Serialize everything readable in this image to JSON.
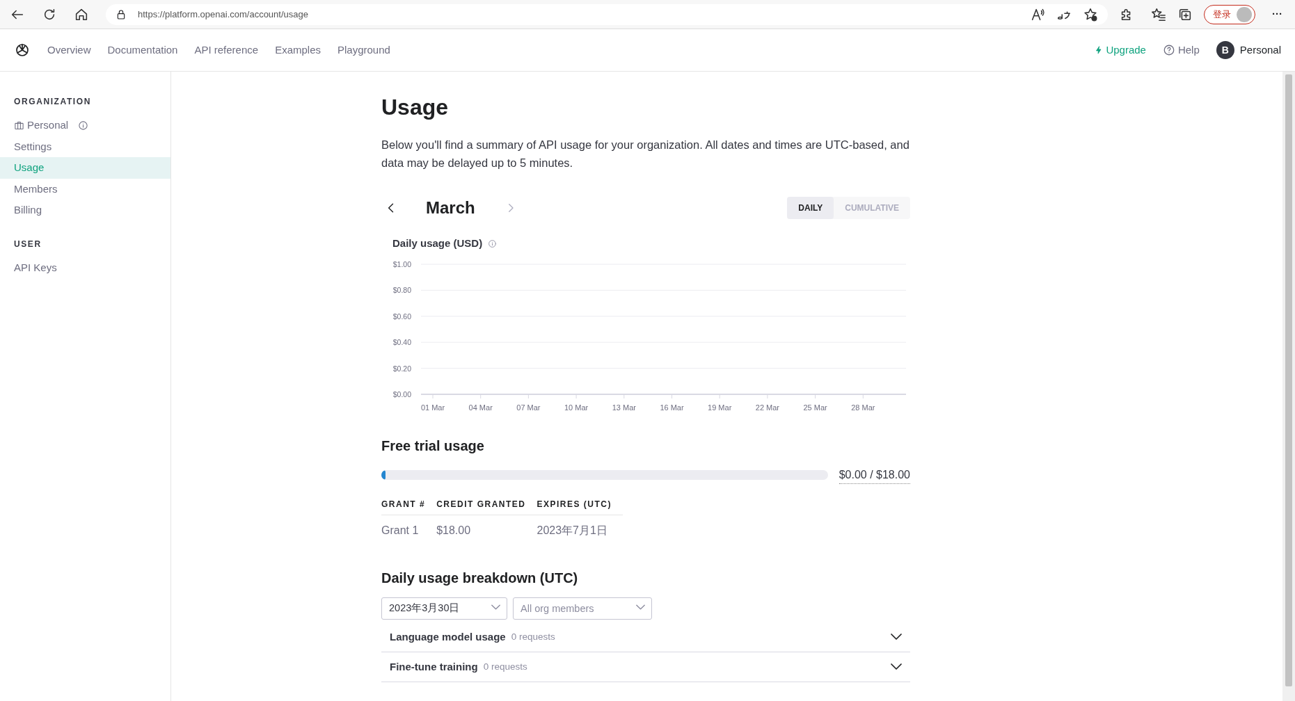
{
  "browser": {
    "url": "https://platform.openai.com/account/usage",
    "login_button": "登录",
    "more": "···"
  },
  "nav": {
    "items": [
      {
        "label": "Overview"
      },
      {
        "label": "Documentation"
      },
      {
        "label": "API reference"
      },
      {
        "label": "Examples"
      },
      {
        "label": "Playground"
      }
    ],
    "upgrade": "Upgrade",
    "help": "Help",
    "avatar_letter": "B",
    "account": "Personal"
  },
  "sidebar": {
    "sections": [
      {
        "heading": "ORGANIZATION",
        "items": [
          {
            "label": "Personal",
            "kind": "org",
            "selected": false
          },
          {
            "label": "Settings",
            "kind": "link",
            "selected": false
          },
          {
            "label": "Usage",
            "kind": "link",
            "selected": true
          },
          {
            "label": "Members",
            "kind": "link",
            "selected": false
          },
          {
            "label": "Billing",
            "kind": "link",
            "selected": false
          }
        ]
      },
      {
        "heading": "USER",
        "items": [
          {
            "label": "API Keys",
            "kind": "link",
            "selected": false
          }
        ]
      }
    ]
  },
  "page": {
    "title": "Usage",
    "description": "Below you'll find a summary of API usage for your organization. All dates and times are UTC-based, and data may be delayed up to 5 minutes.",
    "month": "March",
    "view_toggle": [
      {
        "label": "DAILY",
        "selected": true
      },
      {
        "label": "CUMULATIVE",
        "selected": false
      }
    ],
    "chart_data": {
      "type": "bar",
      "title": "Daily usage (USD)",
      "categories": [
        "01 Mar",
        "04 Mar",
        "07 Mar",
        "10 Mar",
        "13 Mar",
        "16 Mar",
        "19 Mar",
        "22 Mar",
        "25 Mar",
        "28 Mar"
      ],
      "values": [
        0,
        0,
        0,
        0,
        0,
        0,
        0,
        0,
        0,
        0
      ],
      "ylim": [
        0,
        1
      ],
      "grid": true,
      "yticks": [
        {
          "value": 0,
          "label": "$0.00"
        },
        {
          "value": 0.2,
          "label": "$0.20"
        },
        {
          "value": 0.4,
          "label": "$0.40"
        },
        {
          "value": 0.6,
          "label": "$0.60"
        },
        {
          "value": 0.8,
          "label": "$0.80"
        },
        {
          "value": 1,
          "label": "$1.00"
        }
      ]
    }
  },
  "free_trial": {
    "title": "Free trial usage",
    "level": 0.01,
    "reading": "$0.00 / $18.00",
    "columns": [
      "GRANT #",
      "CREDIT GRANTED",
      "EXPIRES (UTC)"
    ],
    "rows": [
      [
        "Grant 1",
        "$18.00",
        "2023年7月1日"
      ]
    ]
  },
  "breakdown": {
    "title": "Daily usage breakdown (UTC)",
    "filters": [
      {
        "value": "2023年3月30日"
      },
      {
        "placeholder": "All org members"
      }
    ],
    "sections": [
      {
        "title": "Language model usage",
        "count": "0 requests",
        "expanded": false
      },
      {
        "title": "Fine-tune training",
        "count": "0 requests",
        "expanded": false
      }
    ]
  }
}
